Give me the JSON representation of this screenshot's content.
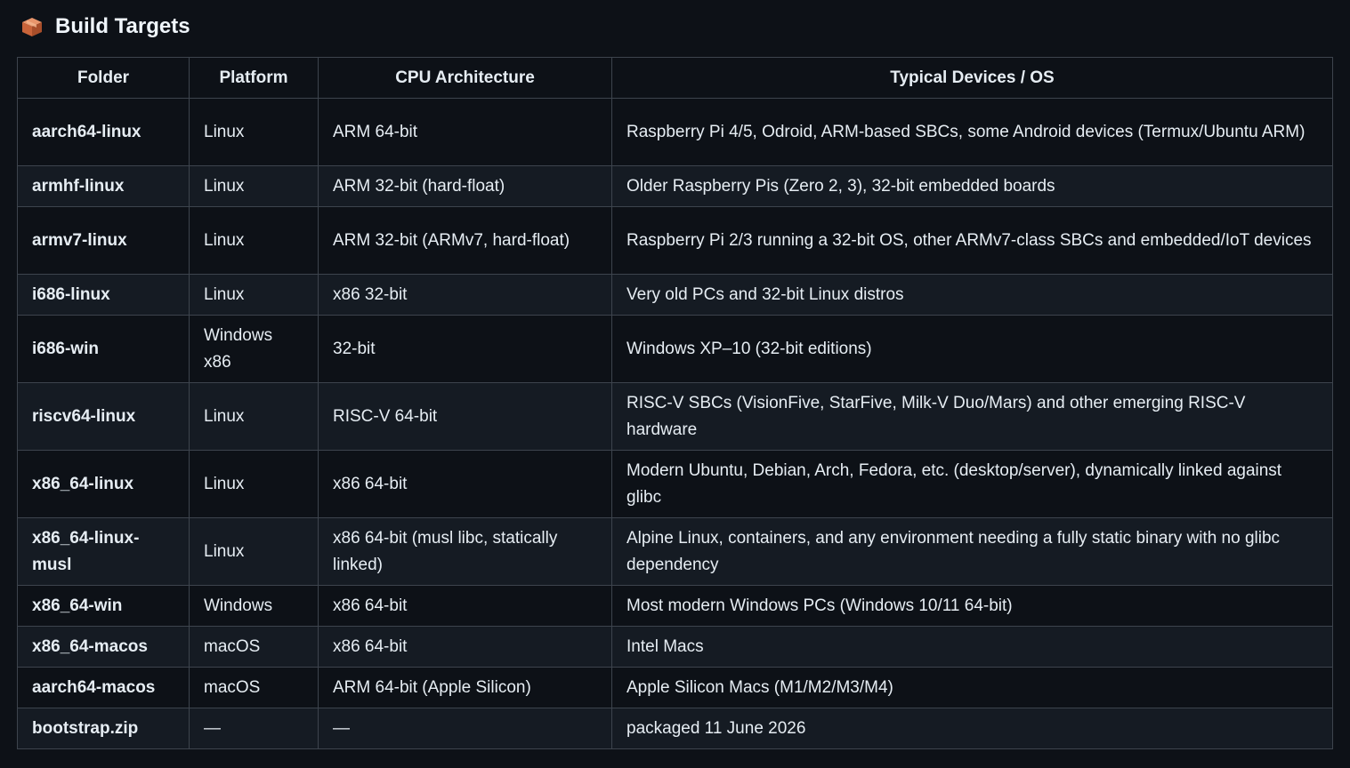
{
  "heading": {
    "icon": "package-box-icon",
    "title": "Build Targets"
  },
  "table": {
    "headers": [
      "Folder",
      "Platform",
      "CPU Architecture",
      "Typical Devices / OS"
    ],
    "rows": [
      {
        "folder": "aarch64-linux",
        "platform": "Linux",
        "cpu": "ARM 64-bit",
        "devices": "Raspberry Pi 4/5, Odroid, ARM-based SBCs, some Android devices (Termux/Ubuntu ARM)"
      },
      {
        "folder": "armhf-linux",
        "platform": "Linux",
        "cpu": "ARM 32-bit (hard-float)",
        "devices": "Older Raspberry Pis (Zero 2, 3), 32-bit embedded boards"
      },
      {
        "folder": "armv7-linux",
        "platform": "Linux",
        "cpu": "ARM 32-bit (ARMv7, hard-float)",
        "devices": "Raspberry Pi 2/3 running a 32-bit OS, other ARMv7-class SBCs and embedded/IoT devices"
      },
      {
        "folder": "i686-linux",
        "platform": "Linux",
        "cpu": "x86 32-bit",
        "devices": "Very old PCs and 32-bit Linux distros"
      },
      {
        "folder": "i686-win",
        "platform": "Windows x86",
        "cpu": "32-bit",
        "devices": "Windows XP–10 (32-bit editions)"
      },
      {
        "folder": "riscv64-linux",
        "platform": "Linux",
        "cpu": "RISC-V 64-bit",
        "devices": "RISC-V SBCs (VisionFive, StarFive, Milk-V Duo/Mars) and other emerging RISC-V hardware"
      },
      {
        "folder": "x86_64-linux",
        "platform": "Linux",
        "cpu": "x86 64-bit",
        "devices": "Modern Ubuntu, Debian, Arch, Fedora, etc. (desktop/server), dynamically linked against glibc"
      },
      {
        "folder": "x86_64-linux-musl",
        "platform": "Linux",
        "cpu": "x86 64-bit (musl libc, statically linked)",
        "devices": "Alpine Linux, containers, and any environment needing a fully static binary with no glibc dependency"
      },
      {
        "folder": "x86_64-win",
        "platform": "Windows",
        "cpu": "x86 64-bit",
        "devices": "Most modern Windows PCs (Windows 10/11 64-bit)"
      },
      {
        "folder": "x86_64-macos",
        "platform": "macOS",
        "cpu": "x86 64-bit",
        "devices": "Intel Macs"
      },
      {
        "folder": "aarch64-macos",
        "platform": "macOS",
        "cpu": "ARM 64-bit (Apple Silicon)",
        "devices": "Apple Silicon Macs (M1/M2/M3/M4)"
      },
      {
        "folder": "bootstrap.zip",
        "platform": "—",
        "cpu": "—",
        "devices": "packaged 11 June 2026"
      }
    ]
  }
}
